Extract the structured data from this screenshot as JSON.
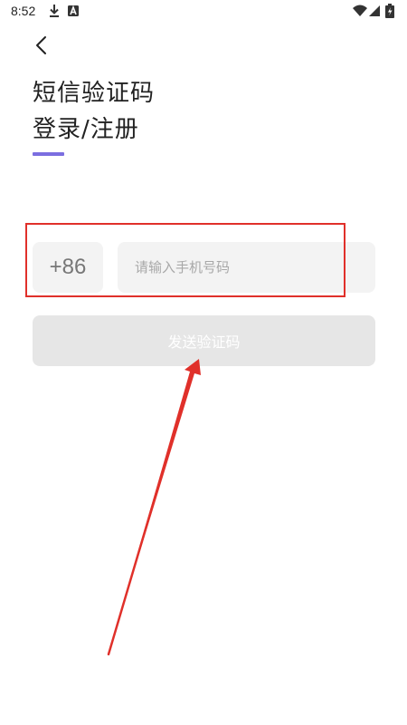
{
  "status_bar": {
    "time": "8:52",
    "icons": [
      "download-icon",
      "notification-a-icon",
      "wifi-icon",
      "signal-icon",
      "battery-charging-icon"
    ]
  },
  "header": {
    "back_icon": "chevron-left-icon",
    "title_line1": "短信验证码",
    "title_line2": "登录/注册",
    "accent_color": "#7b6ee0"
  },
  "form": {
    "country_code": "+86",
    "phone_placeholder": "请输入手机号码",
    "phone_value": "",
    "send_code_label": "发送验证码"
  },
  "annotations": {
    "highlight_color": "#e0302a"
  }
}
